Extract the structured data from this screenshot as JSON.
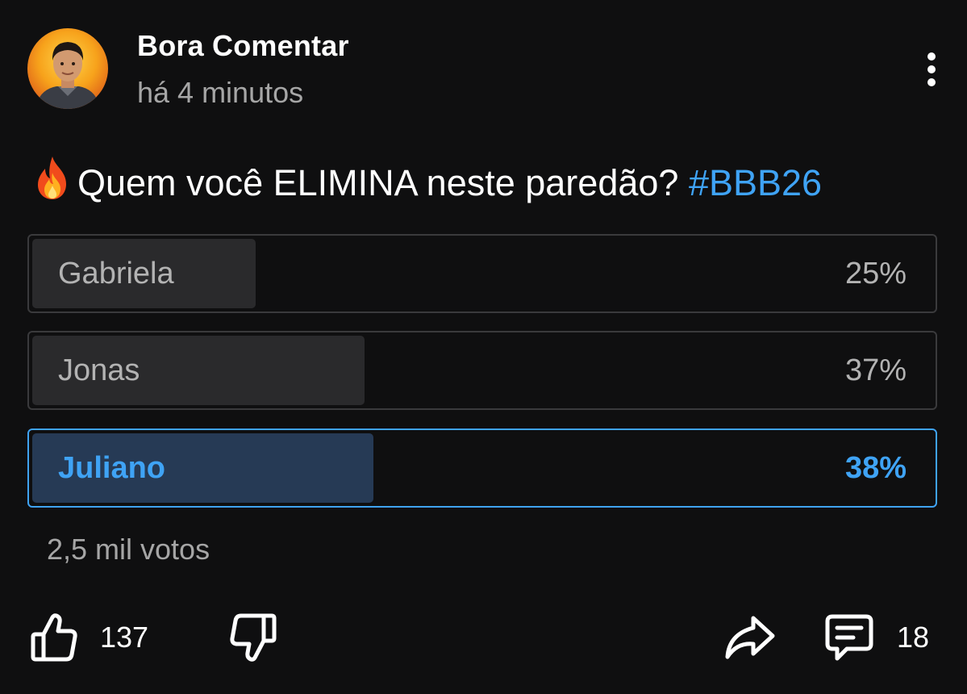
{
  "post": {
    "author": "Bora Comentar",
    "time": "há 4 minutos",
    "question": "Quem você ELIMINA neste paredão?",
    "hashtag": "#BBB26",
    "poll": {
      "options": [
        {
          "label": "Gabriela",
          "percent": "25%",
          "fraction": 0.25,
          "selected": false
        },
        {
          "label": "Jonas",
          "percent": "37%",
          "fraction": 0.37,
          "selected": false
        },
        {
          "label": "Juliano",
          "percent": "38%",
          "fraction": 0.38,
          "selected": true
        }
      ],
      "votes": "2,5 mil votos"
    },
    "actions": {
      "likes": "137",
      "comments": "18"
    }
  },
  "colors": {
    "background": "#0f0f10",
    "accent": "#3fa3f5",
    "selected_fill": "#263a55",
    "option_fill": "#2a2a2c"
  },
  "icons": [
    "avatar",
    "more-vertical-icon",
    "fire-icon",
    "thumbs-up-icon",
    "thumbs-down-icon",
    "share-icon",
    "comment-icon"
  ]
}
